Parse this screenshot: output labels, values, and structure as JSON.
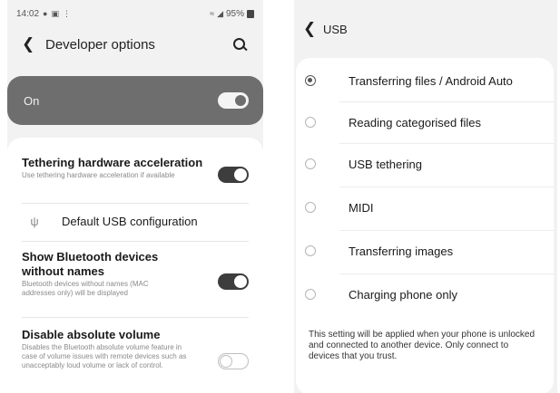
{
  "left": {
    "status_bar": {
      "time": "14:02",
      "left_icons": [
        "location-icon",
        "gallery-icon",
        "notification-icon"
      ],
      "right_icons": [
        "wifi-icon",
        "signal-icon"
      ],
      "battery": "95%"
    },
    "header": {
      "title": "Developer options",
      "back_icon": "chevron-left-icon",
      "search_icon": "search-icon"
    },
    "master": {
      "label": "On",
      "enabled": true
    },
    "settings": [
      {
        "title": "Tethering hardware acceleration",
        "description": "Use tethering hardware acceleration if available",
        "enabled": true
      },
      {
        "title": "Default USB configuration",
        "icon": "usb-icon"
      },
      {
        "title": "Show Bluetooth devices without names",
        "description": "Bluetooth devices without names (MAC addresses only) will be displayed",
        "enabled": true
      },
      {
        "title": "Disable absolute volume",
        "description": "Disables the Bluetooth absolute volume feature in case of volume issues with remote devices such as unacceptably loud volume or lack of control.",
        "enabled": false
      }
    ]
  },
  "right": {
    "header": {
      "title": "USB",
      "back_icon": "chevron-left-icon"
    },
    "options": [
      {
        "label": "Transferring files / Android Auto",
        "selected": true
      },
      {
        "label": "Reading categorised files",
        "selected": false
      },
      {
        "label": "USB tethering",
        "selected": false
      },
      {
        "label": "MIDI",
        "selected": false
      },
      {
        "label": "Transferring images",
        "selected": false
      },
      {
        "label": "Charging phone only",
        "selected": false
      }
    ],
    "note": "This setting will be applied when your phone is unlocked and connected to another device. Only connect to devices that you trust."
  },
  "colors": {
    "background": "#f2f2f2",
    "card": "#ffffff",
    "master_card": "#6e6e6e",
    "toggle_on": "#3d3d3d"
  }
}
